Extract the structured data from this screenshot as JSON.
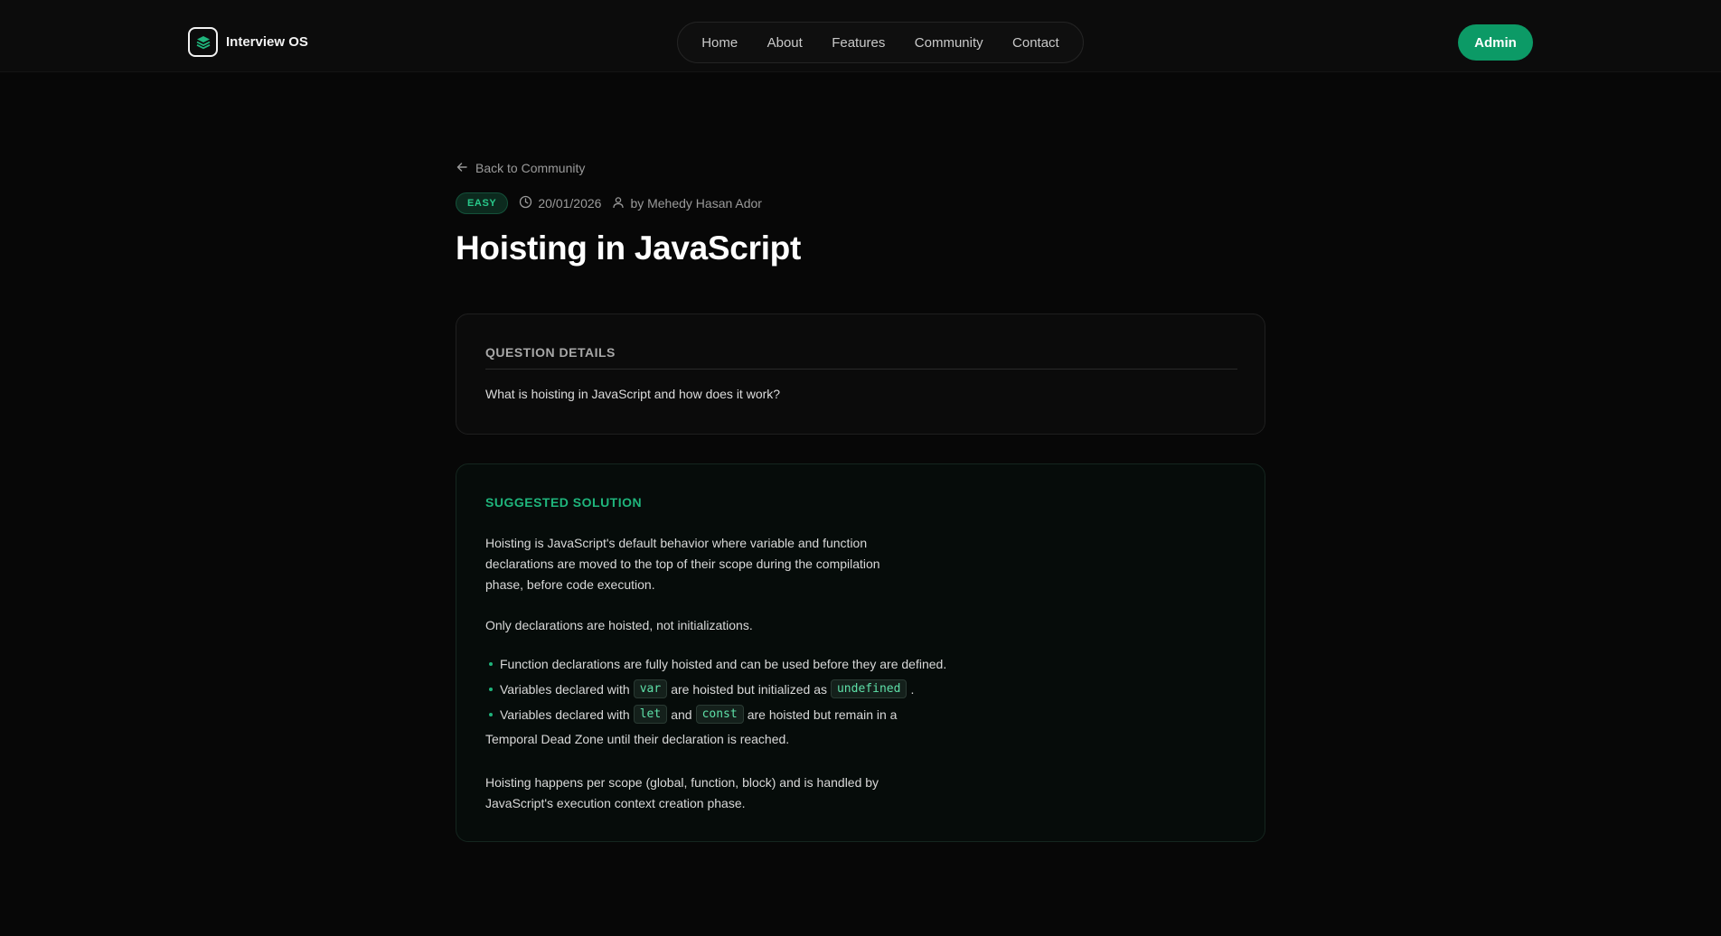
{
  "brand": {
    "name": "Interview OS",
    "icon": "stack-layers-icon",
    "accent": "#1fb57c"
  },
  "nav": {
    "items": [
      "Home",
      "About",
      "Features",
      "Community",
      "Contact"
    ]
  },
  "header": {
    "admin_label": "Admin",
    "admin_color": "#0c9a66"
  },
  "back_link": {
    "label": "Back to Community",
    "icon": "arrow-left-icon"
  },
  "meta": {
    "difficulty": "EASY",
    "date": "20/01/2026",
    "date_icon": "clock-icon",
    "author": "by Mehedy Hasan Ador",
    "author_icon": "user-icon"
  },
  "title": "Hoisting in JavaScript",
  "question": {
    "label": "QUESTION DETAILS",
    "text": "What is hoisting in JavaScript and how does it work?"
  },
  "solution": {
    "label": "SUGGESTED SOLUTION",
    "para1": "Hoisting is JavaScript's default behavior where variable and function declarations are moved to the top of their scope during the compilation phase, before code execution.",
    "para2": "Only declarations are hoisted, not initializations.",
    "bullet1": "Function declarations are fully hoisted and can be used before they are defined.",
    "bullet2": {
      "t1": "Variables declared with",
      "c1": "var",
      "t2": "are hoisted but initialized as",
      "c2": "undefined",
      "t3": "."
    },
    "bullet3": {
      "t1": "Variables declared with",
      "c1": "let",
      "t2": "and",
      "c2": "const",
      "t3": "are hoisted but remain in a",
      "t4": "Temporal Dead Zone until their declaration is reached."
    },
    "para3": "Hoisting happens per scope (global, function, block) and is handled by JavaScript's execution context creation phase."
  }
}
